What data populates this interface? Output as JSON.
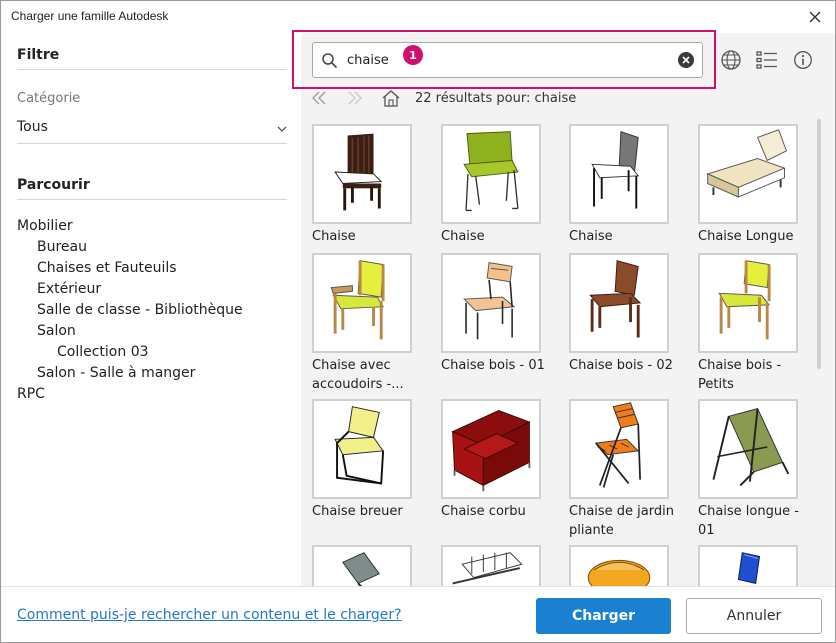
{
  "window": {
    "title": "Charger une famille Autodesk"
  },
  "sidebar": {
    "filter_heading": "Filtre",
    "category_label": "Catégorie",
    "category_value": "Tous",
    "browse_heading": "Parcourir",
    "tree": [
      {
        "label": "Mobilier",
        "level": 0
      },
      {
        "label": "Bureau",
        "level": 1
      },
      {
        "label": "Chaises et Fauteuils",
        "level": 1
      },
      {
        "label": "Extérieur",
        "level": 1
      },
      {
        "label": "Salle de classe - Bibliothèque",
        "level": 1
      },
      {
        "label": "Salon",
        "level": 1
      },
      {
        "label": "Collection 03",
        "level": 2
      },
      {
        "label": "Salon - Salle à manger",
        "level": 1
      },
      {
        "label": "RPC",
        "level": 0
      }
    ]
  },
  "search": {
    "value": "chaise",
    "badge": "1"
  },
  "results": {
    "summary": "22 résultats pour: chaise"
  },
  "items": [
    {
      "name": "Chaise",
      "icon": "chair-dark-wood-icon"
    },
    {
      "name": "Chaise",
      "icon": "chair-green-metal-icon"
    },
    {
      "name": "Chaise",
      "icon": "chair-grey-white-icon"
    },
    {
      "name": "Chaise Longue",
      "icon": "chaise-longue-icon"
    },
    {
      "name": "Chaise avec accoudoirs -...",
      "icon": "armchair-yellow-icon"
    },
    {
      "name": "Chaise bois - 01",
      "icon": "chair-wood-01-icon"
    },
    {
      "name": "Chaise bois - 02",
      "icon": "chair-wood-02-icon"
    },
    {
      "name": "Chaise bois - Petits",
      "icon": "chair-wood-small-icon"
    },
    {
      "name": "Chaise breuer",
      "icon": "chair-breuer-icon"
    },
    {
      "name": "Chaise corbu",
      "icon": "chair-corbu-icon"
    },
    {
      "name": "Chaise de jardin pliante",
      "icon": "folding-garden-chair-icon"
    },
    {
      "name": "Chaise longue - 01",
      "icon": "deck-chair-icon"
    },
    {
      "name": "",
      "icon": "chair-partial-grey-icon"
    },
    {
      "name": "",
      "icon": "bench-partial-icon"
    },
    {
      "name": "",
      "icon": "chair-partial-orange-icon"
    },
    {
      "name": "",
      "icon": "chair-partial-blue-icon"
    }
  ],
  "footer": {
    "help_link": "Comment puis-je rechercher un contenu et le charger?",
    "load_button": "Charger",
    "cancel_button": "Annuler"
  },
  "colors": {
    "accent": "#1a80d0",
    "highlight": "#d1106e",
    "panel_bg": "#f3f3f3"
  }
}
